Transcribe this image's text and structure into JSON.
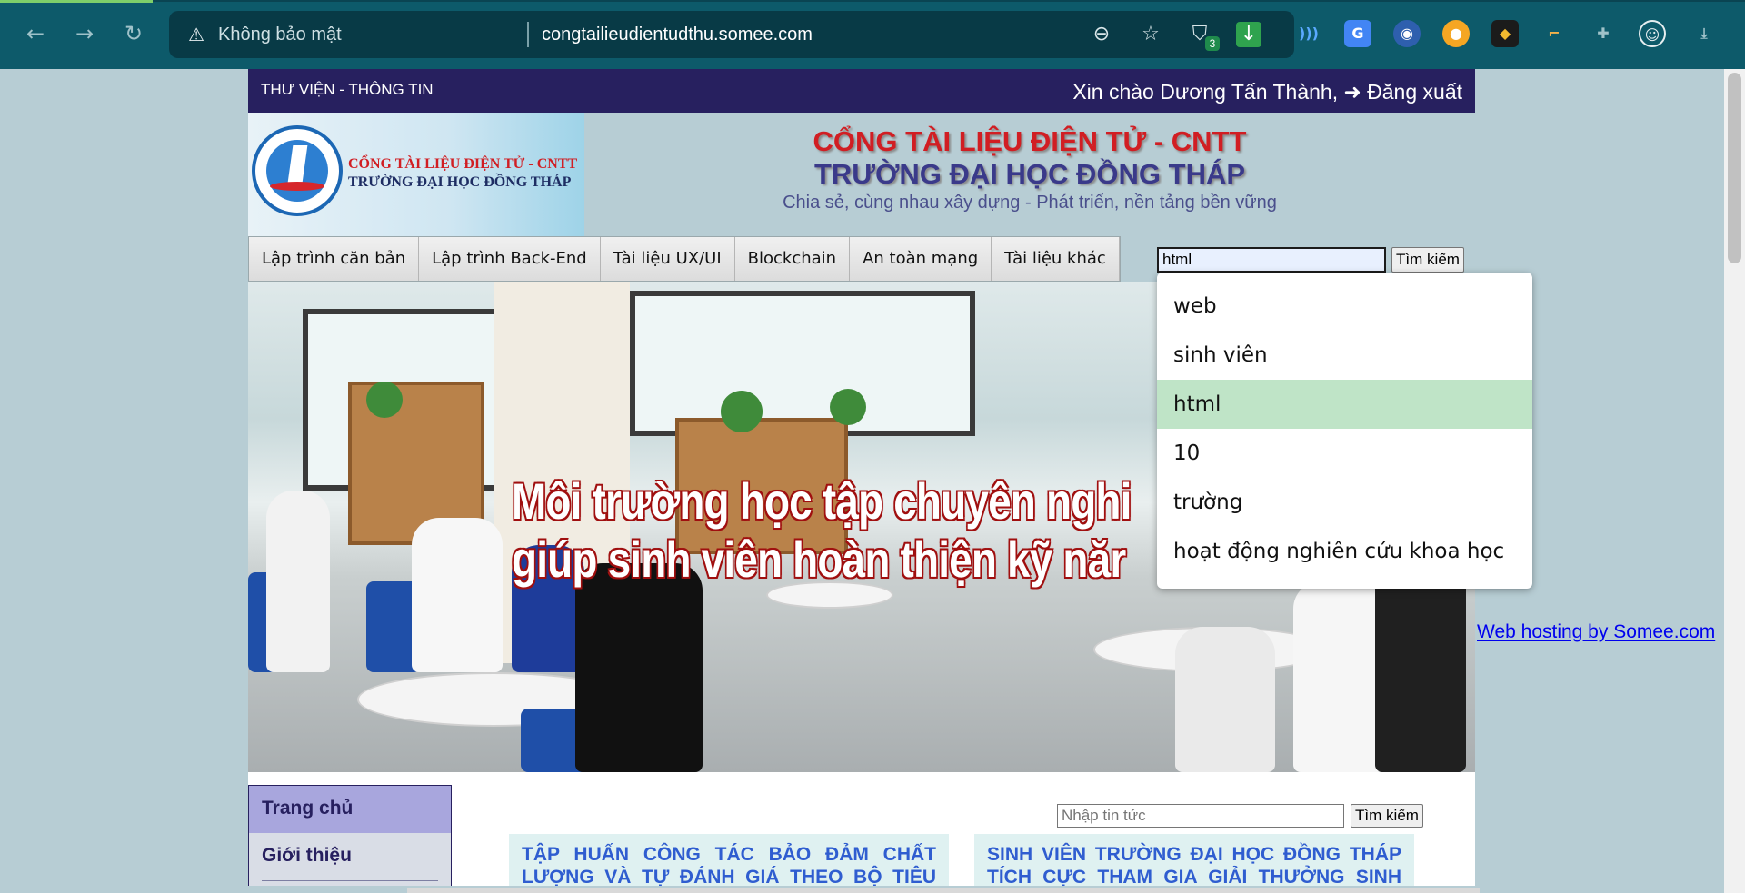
{
  "browser": {
    "security_label": "Không bảo mật",
    "url": "congtailieudientudthu.somee.com",
    "extension_badge": "3"
  },
  "site": {
    "topbar_left": "THƯ VIỆN - THÔNG TIN",
    "greeting": "Xin chào Dương Tấn Thành, ➜ Đăng xuất",
    "logo_line1": "CỔNG TÀI LIỆU ĐIỆN TỬ - CNTT",
    "logo_line2": "TRƯỜNG ĐẠI HỌC ĐỒNG THÁP",
    "title1": "CỔNG TÀI LIỆU ĐIỆN TỬ - CNTT",
    "title2": "TRƯỜNG ĐẠI HỌC ĐỒNG THÁP",
    "tagline": "Chia sẻ, cùng nhau xây dựng - Phát triển, nền tảng bền vững"
  },
  "menu": [
    {
      "label": "Lập trình căn bản"
    },
    {
      "label": "Lập trình Back-End"
    },
    {
      "label": "Tài liệu UX/UI"
    },
    {
      "label": "Blockchain"
    },
    {
      "label": "An toàn mạng"
    },
    {
      "label": "Tài liệu khác"
    }
  ],
  "search": {
    "value": "html",
    "button": "Tìm kiếm",
    "suggestions": [
      {
        "label": "web"
      },
      {
        "label": "sinh viên"
      },
      {
        "label": "html"
      },
      {
        "label": "10"
      },
      {
        "label": "trường"
      },
      {
        "label": "hoạt động nghiên cứu khoa học"
      }
    ],
    "selected": "html"
  },
  "hero": {
    "caption_line1": "Môi trường học tập chuyên nghi",
    "caption_line2": "giúp sinh viên hoàn thiện kỹ năr"
  },
  "sidebar": [
    {
      "label": "Trang chủ"
    },
    {
      "label": "Giới thiệu"
    }
  ],
  "news": {
    "placeholder": "Nhập tin tức",
    "button": "Tìm kiếm",
    "cards": [
      {
        "text": "TẬP HUẤN CÔNG TÁC BẢO ĐẢM CHẤT LƯỢNG VÀ TỰ ĐÁNH GIÁ THEO BỘ TIÊU CHUẨN CẤP CƠ SỞ GIÁO DỤC"
      },
      {
        "text": "SINH VIÊN TRƯỜNG ĐẠI HỌC ĐỒNG THÁP TÍCH CỰC THAM GIA GIẢI THƯỞNG SINH VIÊN NGHIÊN CỨU KHOA HỌC – EUREKA"
      }
    ]
  },
  "footer_link": "Web hosting by Somee.com"
}
